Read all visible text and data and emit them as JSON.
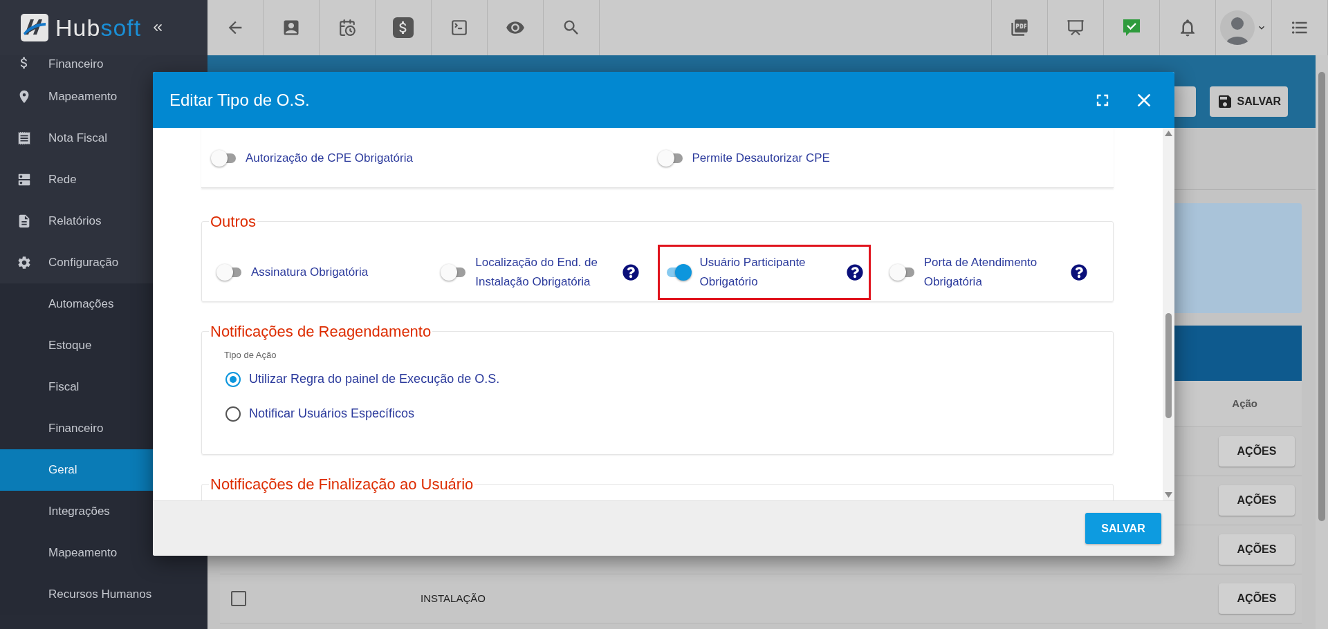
{
  "brand": {
    "name_a": "Hub",
    "name_b": "soft"
  },
  "sidebar": {
    "items": [
      {
        "label": "Financeiro",
        "selected": false,
        "sub": false
      },
      {
        "label": "Mapeamento",
        "selected": false,
        "sub": false
      },
      {
        "label": "Nota Fiscal",
        "selected": false,
        "sub": false
      },
      {
        "label": "Rede",
        "selected": false,
        "sub": false
      },
      {
        "label": "Relatórios",
        "selected": false,
        "sub": false
      },
      {
        "label": "Configuração",
        "selected": false,
        "sub": false
      },
      {
        "label": "Automações",
        "selected": false,
        "sub": true
      },
      {
        "label": "Estoque",
        "selected": false,
        "sub": true
      },
      {
        "label": "Fiscal",
        "selected": false,
        "sub": true
      },
      {
        "label": "Financeiro",
        "selected": false,
        "sub": true
      },
      {
        "label": "Geral",
        "selected": true,
        "sub": true
      },
      {
        "label": "Integrações",
        "selected": false,
        "sub": true
      },
      {
        "label": "Mapeamento",
        "selected": false,
        "sub": true
      },
      {
        "label": "Recursos Humanos",
        "selected": false,
        "sub": true
      }
    ]
  },
  "page": {
    "save_button": "SALVAR",
    "table": {
      "action_header": "Ação",
      "rows": [
        {
          "action": "AÇÕES"
        },
        {
          "action": "AÇÕES"
        },
        {
          "action": "AÇÕES"
        },
        {
          "checked": false,
          "type": "INSTALAÇÃO",
          "action": "AÇÕES"
        }
      ]
    }
  },
  "modal": {
    "title": "Editar Tipo de O.S.",
    "top_toggles": [
      {
        "label": "Autorização de CPE Obrigatória",
        "on": false
      },
      {
        "label": "Permite Desautorizar CPE",
        "on": false
      }
    ],
    "outros": {
      "title": "Outros",
      "items": [
        {
          "label": "Assinatura Obrigatória",
          "on": false,
          "help": false,
          "highlighted": false
        },
        {
          "label": "Localização do End. de Instalação Obrigatória",
          "on": false,
          "help": true,
          "highlighted": false
        },
        {
          "label": "Usuário Participante Obrigatório",
          "on": true,
          "help": true,
          "highlighted": true
        },
        {
          "label": "Porta de Atendimento Obrigatória",
          "on": false,
          "help": true,
          "highlighted": false
        }
      ]
    },
    "reagendamento": {
      "title": "Notificações de Reagendamento",
      "field_label": "Tipo de Ação",
      "options": [
        {
          "label": "Utilizar Regra do painel de Execução de O.S.",
          "selected": true
        },
        {
          "label": "Notificar Usuários Específicos",
          "selected": false
        }
      ]
    },
    "finalizacao": {
      "title": "Notificações de Finalização ao Usuário"
    },
    "save_button": "SALVAR"
  }
}
